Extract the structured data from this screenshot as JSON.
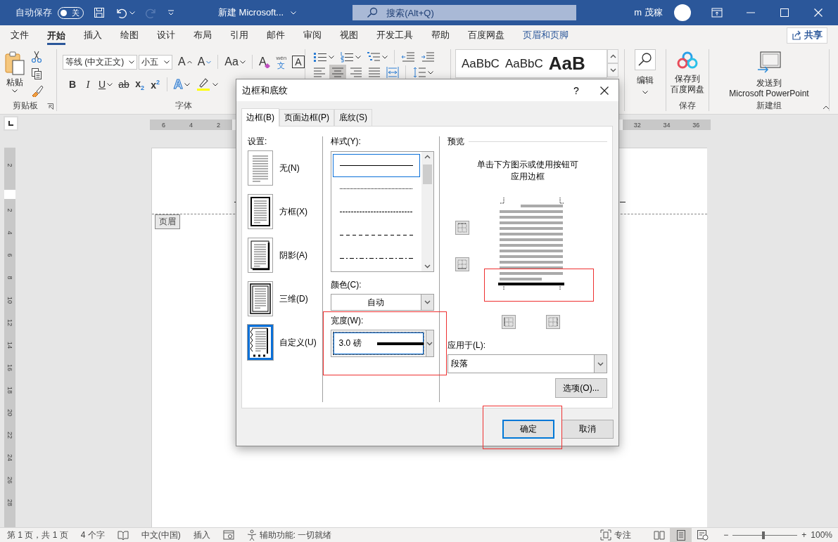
{
  "title_bar": {
    "autosave_label": "自动保存",
    "autosave_toggle": {
      "on": false,
      "label": "关"
    },
    "document_title": "新建 Microsoft...",
    "search_placeholder": "搜索(Alt+Q)",
    "user_name": "m 茂稼"
  },
  "ribbon_tabs": [
    {
      "label": "文件",
      "selected": false,
      "contextual": false
    },
    {
      "label": "开始",
      "selected": true,
      "contextual": false
    },
    {
      "label": "插入",
      "selected": false,
      "contextual": false
    },
    {
      "label": "绘图",
      "selected": false,
      "contextual": false
    },
    {
      "label": "设计",
      "selected": false,
      "contextual": false
    },
    {
      "label": "布局",
      "selected": false,
      "contextual": false
    },
    {
      "label": "引用",
      "selected": false,
      "contextual": false
    },
    {
      "label": "邮件",
      "selected": false,
      "contextual": false
    },
    {
      "label": "审阅",
      "selected": false,
      "contextual": false
    },
    {
      "label": "视图",
      "selected": false,
      "contextual": false
    },
    {
      "label": "开发工具",
      "selected": false,
      "contextual": false
    },
    {
      "label": "帮助",
      "selected": false,
      "contextual": false
    },
    {
      "label": "百度网盘",
      "selected": false,
      "contextual": false
    },
    {
      "label": "页眉和页脚",
      "selected": false,
      "contextual": true
    }
  ],
  "share_button": "共享",
  "clipboard_group": {
    "paste_label": "粘贴",
    "label": "剪贴板"
  },
  "font_group": {
    "font_name": "等线 (中文正文)",
    "font_size": "小五",
    "row_1": [
      {
        "kind": "grow",
        "label": "A"
      },
      {
        "kind": "shrink",
        "label": "A"
      },
      {
        "kind": "separator"
      },
      {
        "kind": "change_case",
        "label": "Aa",
        "caret": true
      },
      {
        "kind": "separator"
      },
      {
        "kind": "clear",
        "label": "A"
      },
      {
        "kind": "pinyin",
        "label": "文",
        "ruby": "wén"
      },
      {
        "kind": "boxed",
        "label": "A"
      }
    ],
    "row_2": [
      {
        "kind": "bold",
        "label": "B"
      },
      {
        "kind": "italic",
        "label": "I"
      },
      {
        "kind": "underline",
        "label": "U",
        "caret": true
      },
      {
        "kind": "strike",
        "label": "ab"
      },
      {
        "kind": "subscript",
        "label": "x$_{2}$"
      },
      {
        "kind": "superscript",
        "label": "x$^{2}$"
      },
      {
        "kind": "separator"
      },
      {
        "kind": "effect",
        "label": "A",
        "caret": true
      },
      {
        "kind": "highlight",
        "caret": true
      }
    ],
    "label": "字体"
  },
  "paragraph_group": {
    "row_1": [
      {
        "kind": "bullets",
        "caret": true
      },
      {
        "kind": "numbering",
        "caret": true
      },
      {
        "kind": "multilevel",
        "caret": true
      },
      {
        "kind": "separator"
      },
      {
        "kind": "outdent"
      },
      {
        "kind": "indent"
      }
    ],
    "row_2": [
      {
        "kind": "align_left",
        "selected": false
      },
      {
        "kind": "center",
        "selected": true
      },
      {
        "kind": "align_right",
        "selected": false
      },
      {
        "kind": "justify",
        "selected": false
      },
      {
        "kind": "distribute",
        "selected": false
      },
      {
        "kind": "separator"
      },
      {
        "kind": "line_spacing",
        "caret": true
      }
    ]
  },
  "styles_group": {
    "samples": [
      {
        "text": "AaBbC",
        "kind": "normal"
      },
      {
        "text": "AaBbC",
        "kind": "normal"
      },
      {
        "text": "AaB",
        "kind": "heading"
      }
    ]
  },
  "editing_group": {
    "label": "编辑"
  },
  "save_group": {
    "button_lines": [
      "保存到",
      "百度网盘"
    ],
    "label": "保存"
  },
  "new_group": {
    "button_lines": [
      "发送到",
      "Microsoft PowerPoint"
    ],
    "label": "新建组"
  },
  "horizontal_ruler": {
    "left_labels": [
      "6",
      "4",
      "2"
    ],
    "right_labels": [
      "32",
      "34",
      "36"
    ]
  },
  "vertical_ruler": {
    "top_labels": [
      "2"
    ],
    "labels": [
      "2",
      "4",
      "6",
      "8",
      "10",
      "12",
      "14",
      "16",
      "18",
      "20",
      "22",
      "24",
      "26",
      "28"
    ]
  },
  "page": {
    "header_tag": "页眉"
  },
  "dialog": {
    "title": "边框和底纹",
    "help": "?",
    "tabs": [
      {
        "label": "边框(B)",
        "selected": true
      },
      {
        "label": "页面边框(P)",
        "selected": false
      },
      {
        "label": "底纹(S)",
        "selected": false
      }
    ],
    "setting_label": "设置:",
    "settings": [
      {
        "kind": "none",
        "label": "无(N)",
        "selected": false
      },
      {
        "kind": "box",
        "label": "方框(X)",
        "selected": false
      },
      {
        "kind": "shadow",
        "label": "阴影(A)",
        "selected": false
      },
      {
        "kind": "three_d",
        "label": "三维(D)",
        "selected": false
      },
      {
        "kind": "custom",
        "label": "自定义(U)",
        "selected": true
      }
    ],
    "style_label": "样式(Y):",
    "styles": [
      {
        "kind": "solid",
        "selected": true
      },
      {
        "kind": "dotted",
        "selected": false
      },
      {
        "kind": "fine_dash",
        "selected": false
      },
      {
        "kind": "dash",
        "selected": false
      },
      {
        "kind": "dash_dot",
        "selected": false
      }
    ],
    "color_label": "颜色(C):",
    "color_value": "自动",
    "width_label": "宽度(W):",
    "width_value": "3.0 磅",
    "preview_label": "预览",
    "preview_hint": "单击下方图示或使用按钮可应用边框",
    "border_buttons": [
      {
        "kind": "top"
      },
      {
        "kind": "bottom"
      },
      {
        "kind": "left"
      },
      {
        "kind": "right"
      }
    ],
    "apply_label": "应用于(L):",
    "apply_value": "段落",
    "options_button": "选项(O)...",
    "ok_button": "确定",
    "cancel_button": "取消"
  },
  "annotations": {
    "width_highlighted": true,
    "preview_highlighted": true,
    "ok_highlighted": true
  },
  "status_bar": {
    "left": [
      {
        "kind": "text",
        "text": "第 1 页，共 1 页"
      },
      {
        "kind": "text",
        "text": "4 个字"
      },
      {
        "kind": "proofing"
      },
      {
        "kind": "text",
        "text": "中文(中国)"
      },
      {
        "kind": "text",
        "text": "插入"
      },
      {
        "kind": "macro"
      },
      {
        "kind": "accessibility",
        "text": "辅助功能: 一切就绪"
      }
    ],
    "right": [
      {
        "kind": "focus",
        "text": "专注"
      },
      {
        "kind": "read",
        "selected": false
      },
      {
        "kind": "print",
        "selected": true
      },
      {
        "kind": "web",
        "selected": false
      }
    ],
    "zoom": {
      "minus": "−",
      "plus": "+",
      "level": 0.47,
      "value": "100%"
    }
  }
}
